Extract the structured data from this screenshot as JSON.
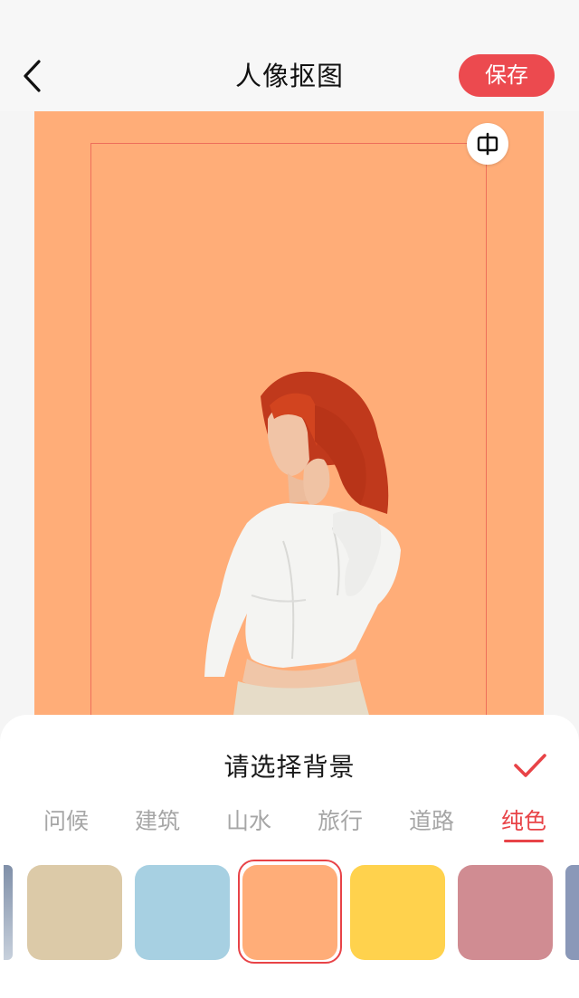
{
  "header": {
    "title": "人像抠图",
    "save_label": "保存"
  },
  "icons": {
    "back": "chevron-left-icon",
    "compare": "compare-split-icon",
    "confirm": "checkmark-icon"
  },
  "canvas": {
    "background_color": "#ffad78",
    "frame_color": "#ee6f5a"
  },
  "sheet": {
    "title": "请选择背景",
    "tabs": [
      {
        "label": "问候",
        "active": false
      },
      {
        "label": "建筑",
        "active": false
      },
      {
        "label": "山水",
        "active": false
      },
      {
        "label": "旅行",
        "active": false
      },
      {
        "label": "道路",
        "active": false
      },
      {
        "label": "纯色",
        "active": true
      }
    ],
    "swatches": [
      {
        "color": "#dccaa8",
        "selected": false
      },
      {
        "color": "#a7d0e2",
        "selected": false
      },
      {
        "color": "#ffad78",
        "selected": true
      },
      {
        "color": "#ffd24d",
        "selected": false
      },
      {
        "color": "#d08c92",
        "selected": false
      }
    ]
  },
  "colors": {
    "accent": "#e84347",
    "save_button": "#ec4a4f",
    "inactive_tab": "#a6a6a6"
  }
}
